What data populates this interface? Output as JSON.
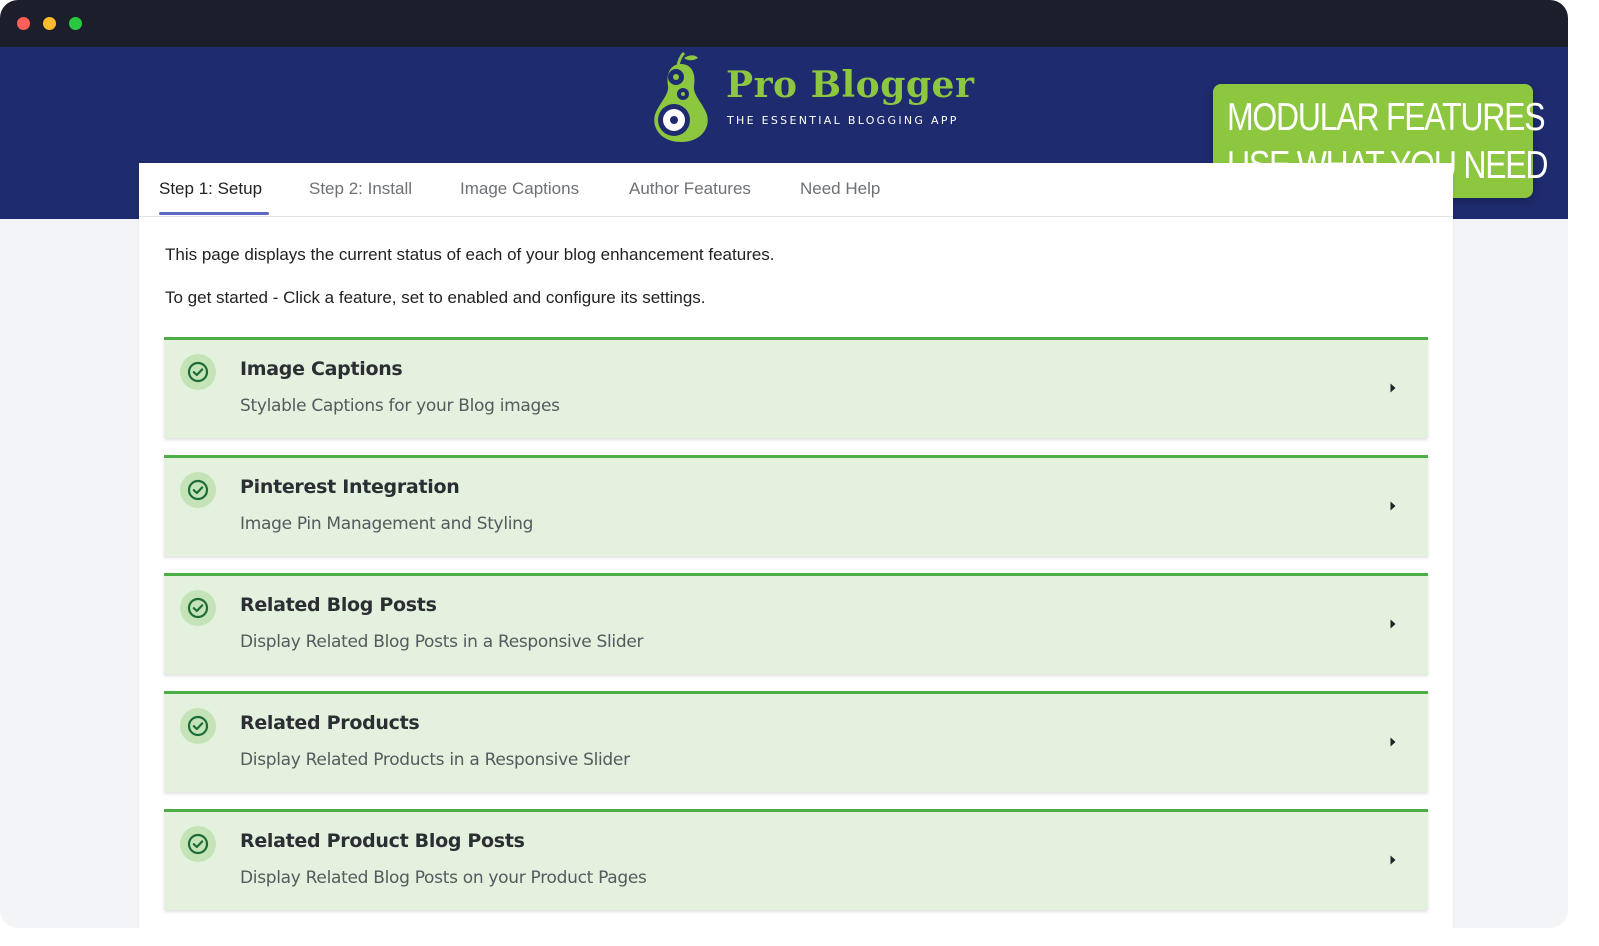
{
  "window": {
    "controls": [
      "close",
      "minimize",
      "zoom"
    ]
  },
  "brand": {
    "name": "Pro Blogger",
    "tagline": "THE ESSENTIAL BLOGGING APP",
    "logo_icon": "pear-gears-logo"
  },
  "promo": {
    "line1": "MODULAR FEATURES",
    "line2": "USE WHAT YOU NEED"
  },
  "tabs": [
    {
      "label": "Step 1: Setup",
      "active": true
    },
    {
      "label": "Step 2: Install",
      "active": false
    },
    {
      "label": "Image Captions",
      "active": false
    },
    {
      "label": "Author Features",
      "active": false
    },
    {
      "label": "Need Help",
      "active": false
    }
  ],
  "intro": {
    "line1": "This page displays the current status of each of your blog enhancement features.",
    "line2": "To get started - Click a feature, set to enabled and configure its settings."
  },
  "features": [
    {
      "title": "Image Captions",
      "description": "Stylable Captions for your Blog images",
      "status_icon": "check-circle-icon",
      "action_icon": "caret-right-icon"
    },
    {
      "title": "Pinterest Integration",
      "description": "Image Pin Management and Styling",
      "status_icon": "check-circle-icon",
      "action_icon": "caret-right-icon"
    },
    {
      "title": "Related Blog Posts",
      "description": "Display Related Blog Posts in a Responsive Slider",
      "status_icon": "check-circle-icon",
      "action_icon": "caret-right-icon"
    },
    {
      "title": "Related Products",
      "description": "Display Related Products in a Responsive Slider",
      "status_icon": "check-circle-icon",
      "action_icon": "caret-right-icon"
    },
    {
      "title": "Related Product Blog Posts",
      "description": "Display Related Blog Posts on your Product Pages",
      "status_icon": "check-circle-icon",
      "action_icon": "caret-right-icon"
    }
  ],
  "colors": {
    "banner": "#1f2b6f",
    "brand_green": "#8dc63f",
    "feature_bg": "#e3f1de",
    "feature_border": "#4caf45",
    "tab_underline": "#5c6ac4"
  }
}
